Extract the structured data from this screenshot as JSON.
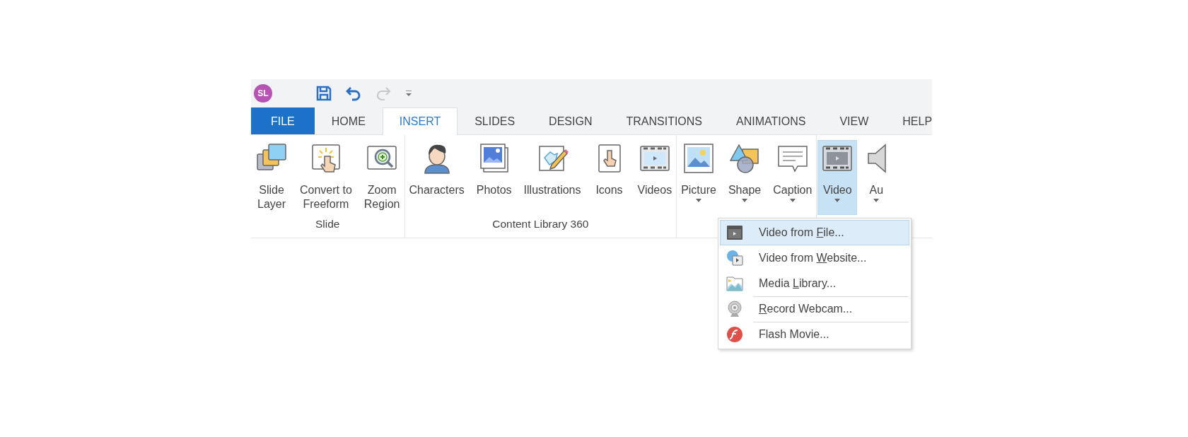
{
  "quick_access": {
    "avatar": "SL",
    "buttons": [
      {
        "kind": "save",
        "disabled": false
      },
      {
        "kind": "undo",
        "disabled": false
      },
      {
        "kind": "redo",
        "disabled": true
      },
      {
        "kind": "customize",
        "disabled": false
      }
    ]
  },
  "tabs": [
    {
      "label": "FILE",
      "kind": "file",
      "selected": false
    },
    {
      "label": "HOME",
      "kind": "tab",
      "selected": false
    },
    {
      "label": "INSERT",
      "kind": "tab",
      "selected": true
    },
    {
      "label": "SLIDES",
      "kind": "tab",
      "selected": false
    },
    {
      "label": "DESIGN",
      "kind": "tab",
      "selected": false
    },
    {
      "label": "TRANSITIONS",
      "kind": "tab",
      "selected": false
    },
    {
      "label": "ANIMATIONS",
      "kind": "tab",
      "selected": false
    },
    {
      "label": "VIEW",
      "kind": "tab",
      "selected": false
    },
    {
      "label": "HELP",
      "kind": "tab",
      "selected": false
    }
  ],
  "ribbon": {
    "groups": [
      {
        "label": "Slide",
        "items": [
          {
            "kind": "layers",
            "label_lines": [
              "Slide",
              "Layer"
            ],
            "dropdown": false,
            "selected": false
          },
          {
            "kind": "convert",
            "label_lines": [
              "Convert to",
              "Freeform"
            ],
            "dropdown": false,
            "selected": false
          },
          {
            "kind": "zoom",
            "label_lines": [
              "Zoom",
              "Region"
            ],
            "dropdown": false,
            "selected": false
          }
        ]
      },
      {
        "label": "Content Library 360",
        "items": [
          {
            "kind": "character",
            "label_lines": [
              "Characters"
            ],
            "dropdown": false,
            "selected": false
          },
          {
            "kind": "photos",
            "label_lines": [
              "Photos"
            ],
            "dropdown": false,
            "selected": false
          },
          {
            "kind": "illustration",
            "label_lines": [
              "Illustrations"
            ],
            "dropdown": false,
            "selected": false
          },
          {
            "kind": "icons",
            "label_lines": [
              "Icons"
            ],
            "dropdown": false,
            "selected": false
          },
          {
            "kind": "videos",
            "label_lines": [
              "Videos"
            ],
            "dropdown": false,
            "selected": false
          }
        ]
      },
      {
        "items": [
          {
            "kind": "picture",
            "label_lines": [
              "Picture"
            ],
            "dropdown": true,
            "selected": false
          },
          {
            "kind": "shape",
            "label_lines": [
              "Shape"
            ],
            "dropdown": true,
            "selected": false
          },
          {
            "kind": "caption",
            "label_lines": [
              "Caption"
            ],
            "dropdown": true,
            "selected": false
          }
        ]
      },
      {
        "items": [
          {
            "kind": "video",
            "label_lines": [
              "Video"
            ],
            "dropdown": true,
            "selected": true
          },
          {
            "kind": "audio",
            "label_lines": [
              "Au"
            ],
            "dropdown": true,
            "selected": false
          }
        ]
      }
    ]
  },
  "video_menu": {
    "items": [
      {
        "kind": "file",
        "before": "Video from ",
        "key": "F",
        "after": "ile...",
        "separator_before": false,
        "selected": true
      },
      {
        "kind": "website",
        "before": "Video from ",
        "key": "W",
        "after": "ebsite...",
        "separator_before": false,
        "selected": false
      },
      {
        "kind": "library",
        "before": "Media ",
        "key": "L",
        "after": "ibrary...",
        "separator_before": false,
        "selected": false
      },
      {
        "kind": "webcam",
        "key": "R",
        "after": "ecord Webcam...",
        "separator_before": true,
        "selected": false
      },
      {
        "kind": "flash",
        "before": "Flash Movie...",
        "separator_before": true,
        "selected": false
      }
    ]
  }
}
